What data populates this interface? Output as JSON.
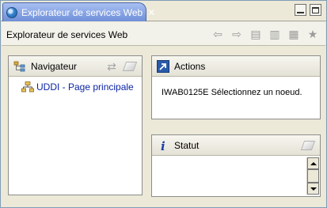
{
  "window": {
    "tab_title": "Explorateur de services Web",
    "close_glyph": "✕"
  },
  "header": {
    "title": "Explorateur de services Web",
    "tools": [
      {
        "icon": "back-arrow-icon",
        "glyph": "⇦"
      },
      {
        "icon": "forward-arrow-icon",
        "glyph": "⇨"
      },
      {
        "icon": "document-icon",
        "glyph": "▤"
      },
      {
        "icon": "document-settings-icon",
        "glyph": "▥"
      },
      {
        "icon": "import-icon",
        "glyph": "▦"
      },
      {
        "icon": "star-icon",
        "glyph": "★"
      }
    ]
  },
  "navigator": {
    "title": "Navigateur",
    "items": [
      {
        "label": "UDDI - Page principale"
      }
    ]
  },
  "actions": {
    "title": "Actions",
    "message": "IWAB0125E Sélectionnez un noeud."
  },
  "status": {
    "title": "Statut"
  },
  "colors": {
    "tab_active": "#6f8fd8",
    "link": "#0b24a6",
    "info_icon": "#1f3fa8"
  }
}
